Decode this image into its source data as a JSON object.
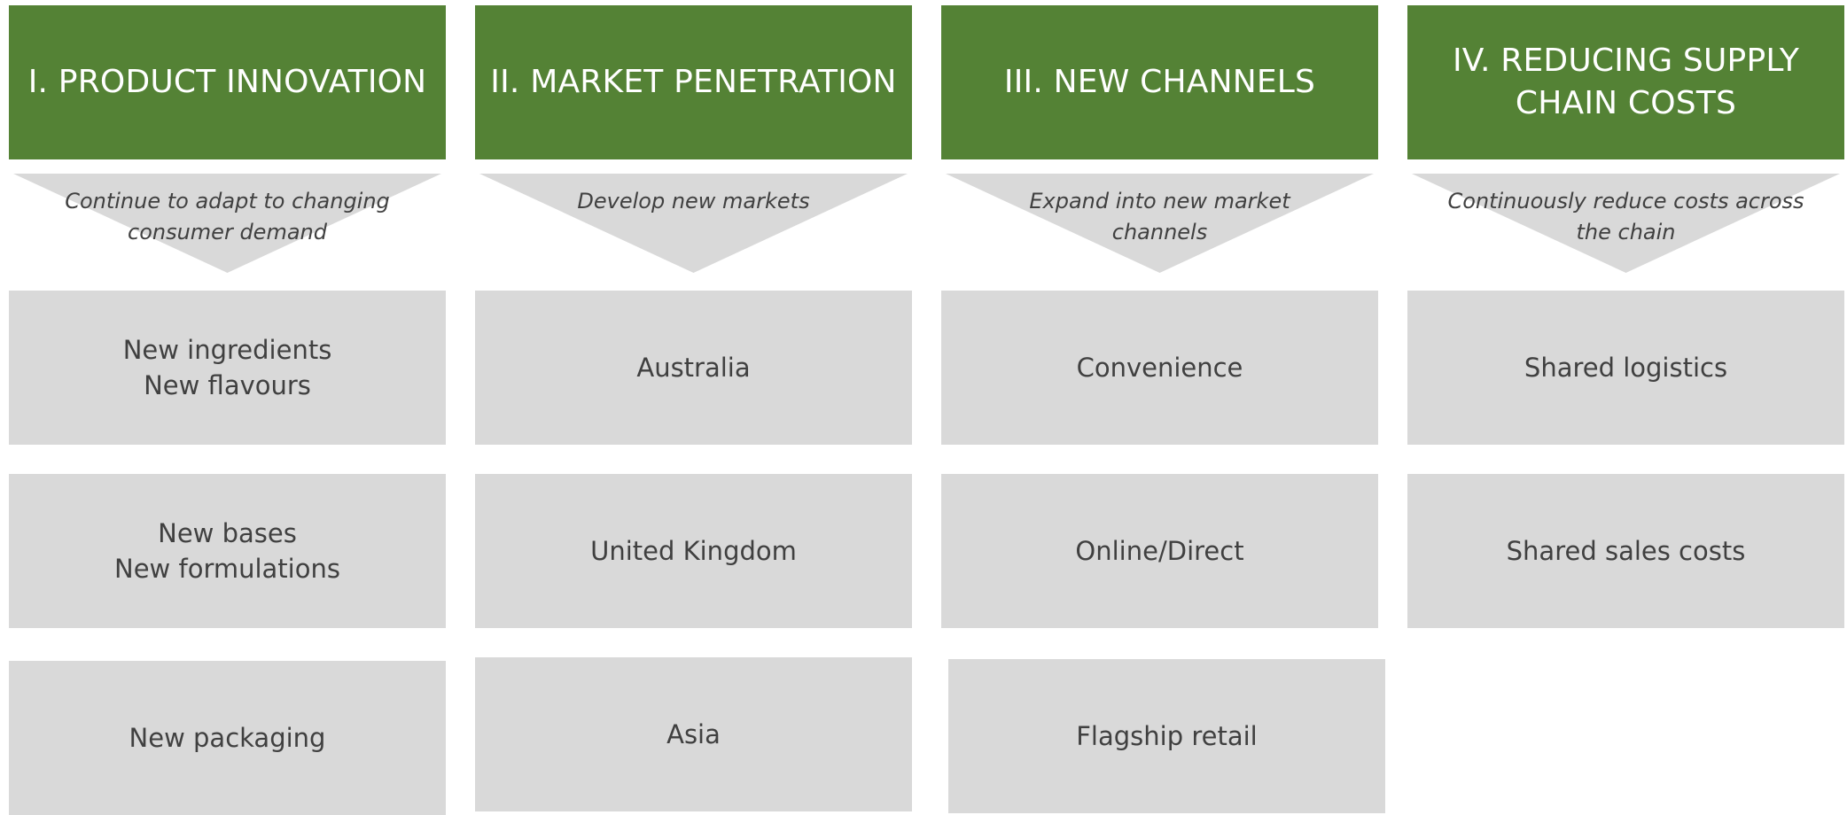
{
  "columns": [
    {
      "header": "I. PRODUCT INNOVATION",
      "subtitle": "Continue to adapt to changing\nconsumer demand",
      "items": [
        "New ingredients\nNew flavours",
        "New bases\nNew formulations",
        "New packaging"
      ]
    },
    {
      "header": "II. MARKET PENETRATION",
      "subtitle": "Develop new markets",
      "items": [
        "Australia",
        "United Kingdom",
        "Asia"
      ]
    },
    {
      "header": "III. NEW CHANNELS",
      "subtitle": "Expand into new market\nchannels",
      "items": [
        "Convenience",
        "Online/Direct",
        "Flagship retail"
      ]
    },
    {
      "header": "IV. REDUCING SUPPLY\nCHAIN COSTS",
      "subtitle": "Continuously reduce costs across\nthe chain",
      "items": [
        "Shared logistics",
        "Shared sales costs"
      ]
    }
  ],
  "colors": {
    "header_bg": "#548235",
    "header_text": "#ffffff",
    "box_bg": "#d9d9d9",
    "text": "#404040"
  }
}
